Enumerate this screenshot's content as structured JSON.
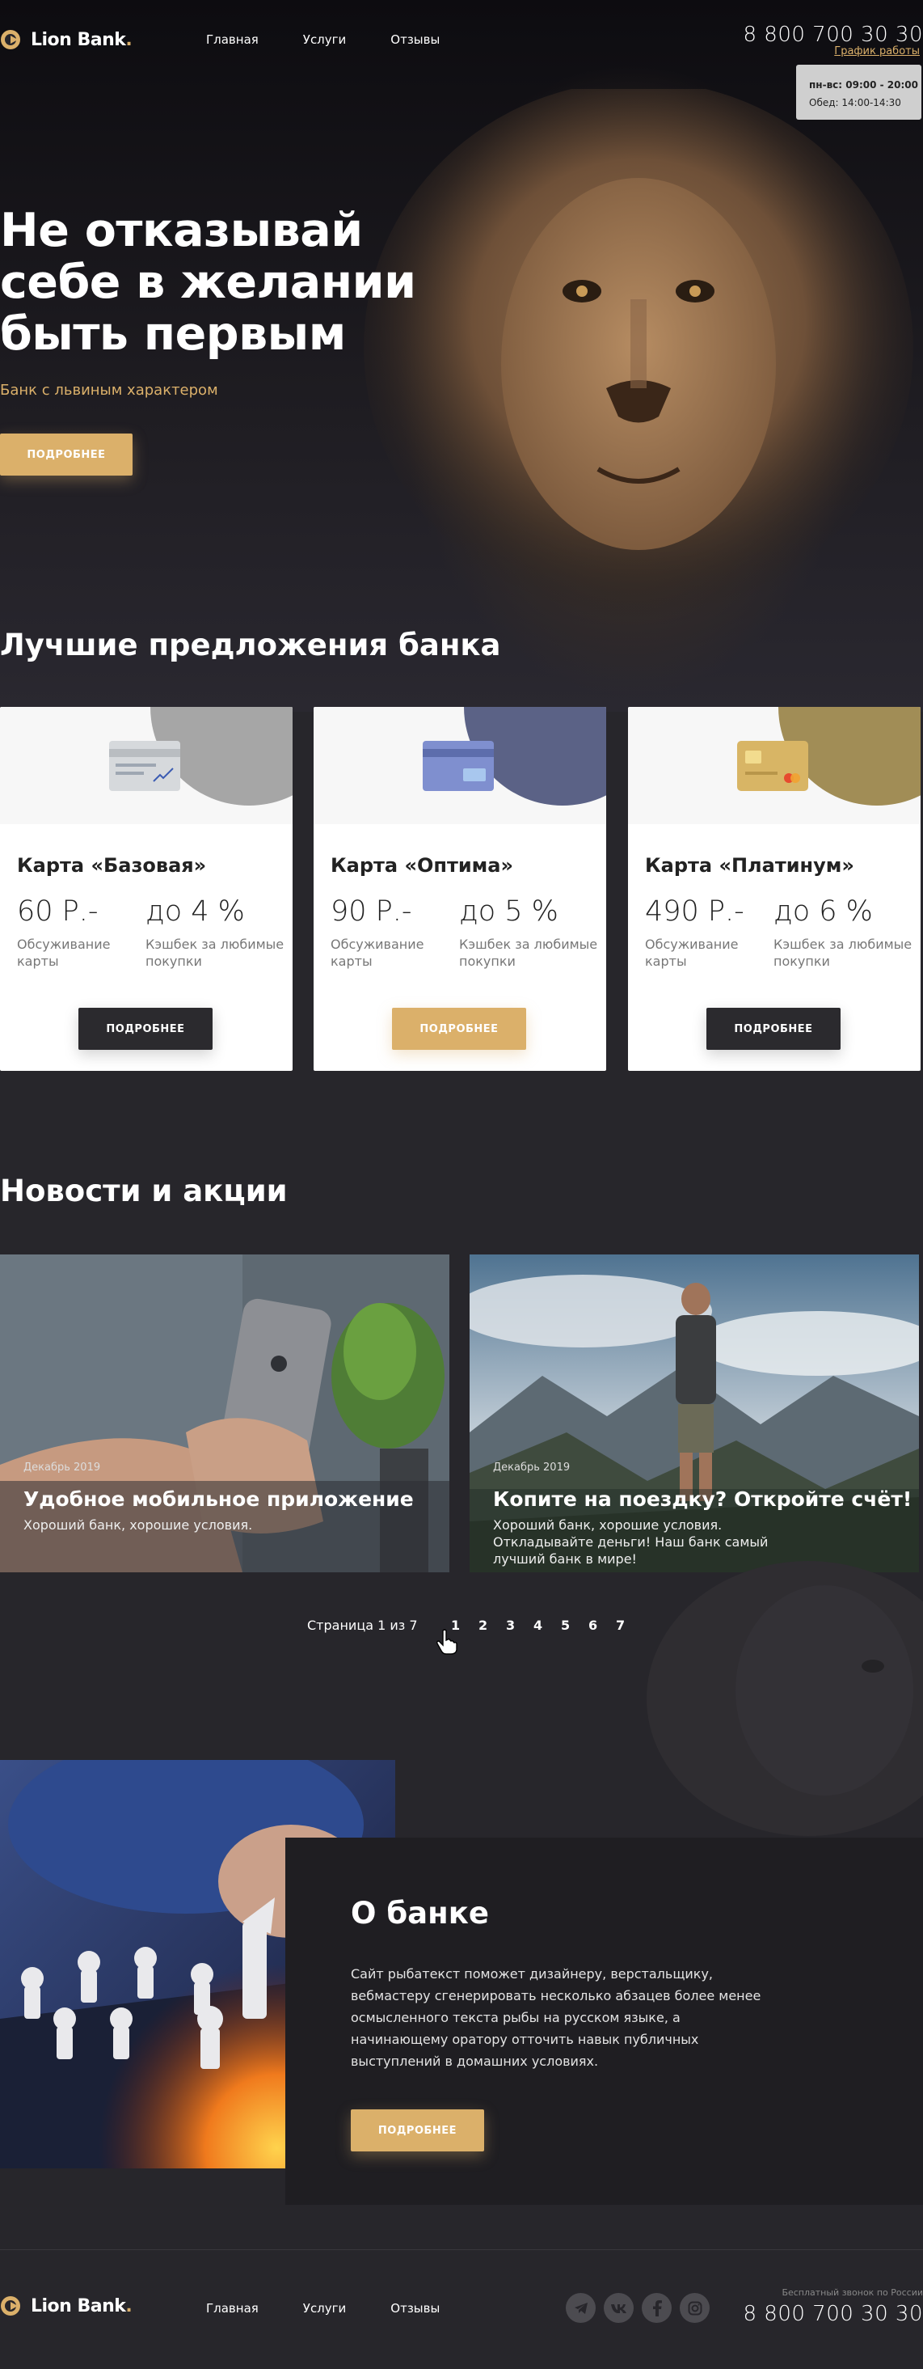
{
  "brand": {
    "name": "Lion Bank",
    "dot": "."
  },
  "nav": [
    {
      "label": "Главная"
    },
    {
      "label": "Услуги"
    },
    {
      "label": "Отзывы"
    }
  ],
  "header": {
    "phone": "8 800 700 30 30",
    "schedule_link": "График работы",
    "schedule_line1": "пн-вс: 09:00 - 20:00",
    "schedule_line2": "Обед: 14:00-14:30"
  },
  "hero": {
    "title": "Не отказывай себе в желании быть первым",
    "subtitle": "Банк с львиным характером",
    "button": "ПОДРОБНЕЕ"
  },
  "offers": {
    "title": "Лучшие предложения банка",
    "cards": [
      {
        "name": "Карта «Базовая»",
        "price": "60 Р.-",
        "price_label": "Обсуживание карты",
        "cashback": "до 4 %",
        "cashback_label": "Кэшбек за любимые покупки",
        "button": "ПОДРОБНЕЕ",
        "accent": "#a6a6a6",
        "card_color": "#d6d9dc",
        "button_style": "dark"
      },
      {
        "name": "Карта «Оптима»",
        "price": "90 Р.-",
        "price_label": "Обсуживание карты",
        "cashback": "до 5 %",
        "cashback_label": "Кэшбек за любимые покупки",
        "button": "ПОДРОБНЕЕ",
        "accent": "#5b6286",
        "card_color": "#7f8fcf",
        "button_style": "gold"
      },
      {
        "name": "Карта «Платинум»",
        "price": "490 Р.-",
        "price_label": "Обсуживание карты",
        "cashback": "до 6 %",
        "cashback_label": "Кэшбек за любимые покупки",
        "button": "ПОДРОБНЕЕ",
        "accent": "#a18d56",
        "card_color": "#d8b565",
        "button_style": "dark"
      }
    ]
  },
  "news": {
    "title": "Новости и акции",
    "items": [
      {
        "date": "Декабрь 2019",
        "title": "Удобное мобильное приложение",
        "text": "Хороший банк, хорошие условия."
      },
      {
        "date": "Декабрь 2019",
        "title": "Копите на поездку? Откройте счёт!",
        "text": "Хороший банк, хорошие условия. Откладывайте деньги!  Наш банк самый лучший банк в мире!"
      }
    ],
    "pager": {
      "info": "Страница 1 из 7",
      "pages": [
        "1",
        "2",
        "3",
        "4",
        "5",
        "6",
        "7"
      ],
      "current": "1"
    }
  },
  "about": {
    "title": "О банке",
    "text": "Сайт рыбатекст поможет дизайнеру, верстальщику, вебмастеру сгенерировать несколько абзацев более менее осмысленного текста рыбы на русском языке, а начинающему оратору отточить навык публичных выступлений в домашних условиях.",
    "button": "ПОДРОБНЕЕ"
  },
  "footer": {
    "free_call": "Бесплатный звонок по России",
    "phone": "8 800 700 30 30",
    "socials": [
      "telegram-icon",
      "vk-icon",
      "facebook-icon",
      "instagram-icon"
    ]
  },
  "colors": {
    "accent": "#dbb06a",
    "background": "#27262b",
    "dark_button": "#2b2a2e"
  }
}
